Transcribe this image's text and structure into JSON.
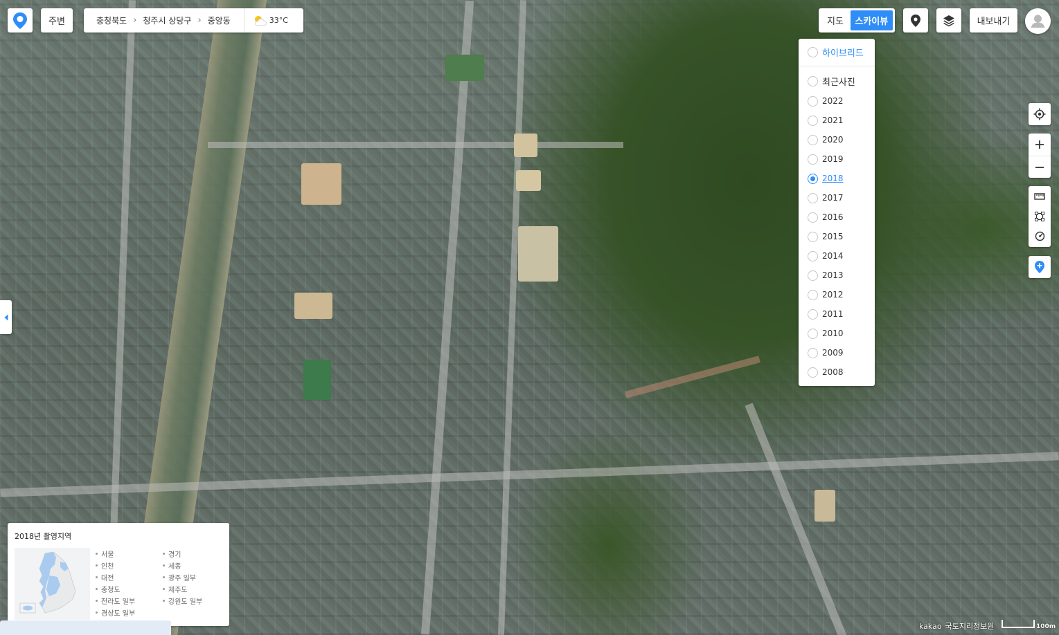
{
  "header": {
    "around_label": "주변",
    "breadcrumb": [
      "충청북도",
      "청주시 상당구",
      "중앙동"
    ],
    "temperature": "33°C",
    "weather_icon": "partly-cloudy-sun-icon"
  },
  "maptype": {
    "map_label": "지도",
    "skyview_label": "스카이뷰",
    "active": "스카이뷰"
  },
  "toolbar": {
    "export_label": "내보내기"
  },
  "year_panel": {
    "hybrid_label": "하이브리드",
    "recent_label": "최근사진",
    "years": [
      "2022",
      "2021",
      "2020",
      "2019",
      "2018",
      "2017",
      "2016",
      "2015",
      "2014",
      "2013",
      "2012",
      "2011",
      "2010",
      "2009",
      "2008"
    ],
    "selected_year": "2018"
  },
  "coverage": {
    "title": "2018년 촬영지역",
    "regions": [
      "서울",
      "경기",
      "인천",
      "세종",
      "대전",
      "광주 일부",
      "충청도",
      "제주도",
      "전라도 일부",
      "강원도 일부",
      "경상도 일부"
    ]
  },
  "attribution": {
    "provider": "kakao",
    "source": "국토지리정보원",
    "scale_label": "100m"
  },
  "colors": {
    "accent": "#2e8df7",
    "coverage_highlight": "#a9cbef"
  }
}
